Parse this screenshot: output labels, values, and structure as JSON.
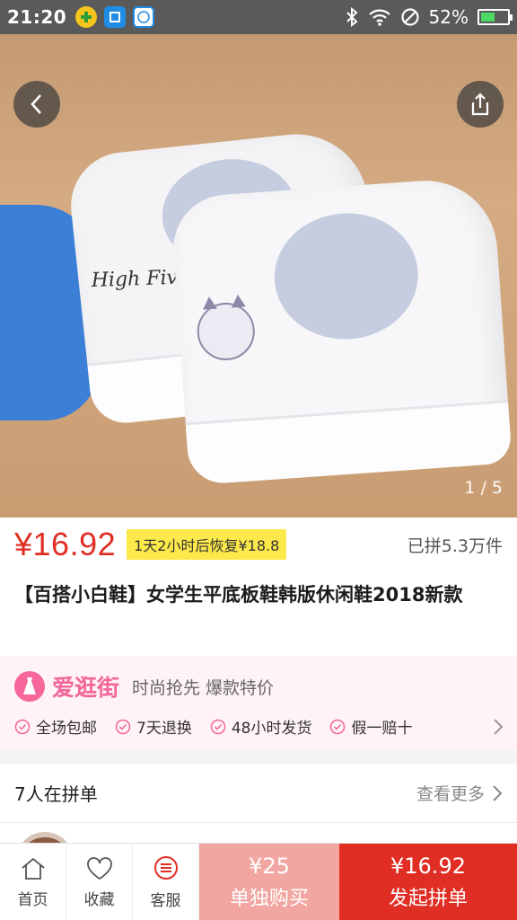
{
  "status_bar": {
    "time": "21:20",
    "battery_percent": "52%",
    "battery_level": 0.52
  },
  "hero": {
    "counter": "1 / 5",
    "shoe_print_text": "High Five"
  },
  "price": {
    "current": "¥16.92",
    "restore_note": "1天2小时后恢复¥18.8",
    "sold": "已拼5.3万件"
  },
  "product": {
    "title": "【百搭小白鞋】女学生平底板鞋韩版休闲鞋2018新款"
  },
  "store": {
    "name": "爱逛街",
    "slogan": "时尚抢先 爆款特价",
    "guarantees": [
      "全场包邮",
      "7天退换",
      "48小时发货",
      "假一赔十"
    ]
  },
  "group_buy": {
    "title": "7人在拼单",
    "more": "查看更多"
  },
  "bottom_bar": {
    "home": "首页",
    "favorite": "收藏",
    "service": "客服",
    "single_price": "¥25",
    "single_label": "单独购买",
    "group_price": "¥16.92",
    "group_label": "发起拼单"
  },
  "colors": {
    "accent_red": "#e02e24",
    "store_pink": "#f2669a",
    "badge_yellow": "#fde94a",
    "single_buy_bg": "#f2a6a1"
  }
}
